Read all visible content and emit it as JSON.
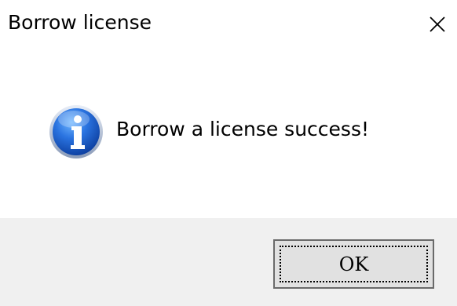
{
  "window": {
    "title": "Borrow license",
    "close_icon": "close-icon"
  },
  "message": {
    "icon": "info-icon",
    "text": "Borrow a license success!"
  },
  "buttons": {
    "ok_label": "OK"
  },
  "colors": {
    "dialog_background": "#ffffff",
    "footer_background": "#f0f0f0",
    "button_face": "#e1e1e1",
    "button_border": "#6a6a6a",
    "info_icon_blue": "#1f5fc8"
  }
}
